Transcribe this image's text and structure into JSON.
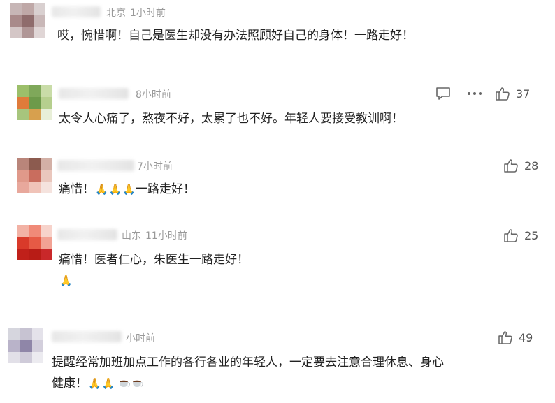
{
  "comments": [
    {
      "location": "北京",
      "time": "1小时前",
      "text": "哎，惋惜啊！自己是医生却没有办法照顾好自己的身体！一路走好！",
      "likes": ""
    },
    {
      "location": "",
      "time": "8小时前",
      "text": "太令人心痛了，熬夜不好，太累了也不好。年轻人要接受教训啊！",
      "likes": "37"
    },
    {
      "location": "",
      "time": "7小时前",
      "text": "痛惜！",
      "text_after": "一路走好！",
      "likes": "28"
    },
    {
      "location": "山东",
      "time": "11小时前",
      "text": "痛惜！医者仁心，朱医生一路走好！",
      "likes": "25"
    },
    {
      "location": "",
      "time": "小时前",
      "text_line1": "提醒经常加班加点工作的各行各业的年轻人，一定要去注意合理休息、身心",
      "text_line2": "健康！",
      "likes": "49"
    }
  ],
  "icons": {
    "reply": "comment-icon",
    "more": "more-icon",
    "like": "thumbs-up-icon",
    "prayer": "folded-hands-emoji",
    "coffee": "hot-beverage-emoji"
  },
  "colors": {
    "text": "#222222",
    "meta": "#999999",
    "icon": "#666666"
  }
}
